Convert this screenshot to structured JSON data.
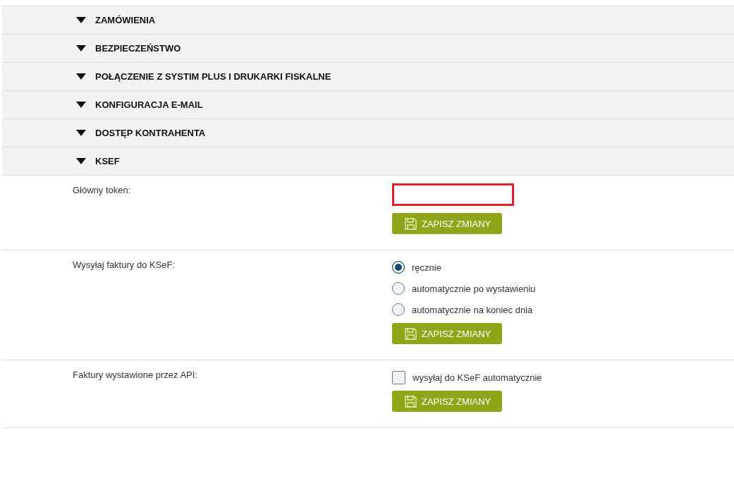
{
  "sections": [
    {
      "title": "ZAMÓWIENIA"
    },
    {
      "title": "BEZPIECZEŃSTWO"
    },
    {
      "title": "POŁĄCZENIE Z SYSTIM PLUS I DRUKARKI FISKALNE"
    },
    {
      "title": "KONFIGURACJA E-MAIL"
    },
    {
      "title": "DOSTĘP KONTRAHENTA"
    },
    {
      "title": "KSEF"
    }
  ],
  "settings": [
    {
      "kind": "field",
      "label": "Główny token:",
      "button": "ZAPISZ ZMIANY"
    },
    {
      "kind": "radio",
      "label": "Wysyłaj faktury do KSeF:",
      "options": [
        {
          "label": "ręcznie",
          "selected": true
        },
        {
          "label": "automatycznie po wystawieniu",
          "selected": false
        },
        {
          "label": "automatycznie na koniec dnia",
          "selected": false
        }
      ],
      "button": "ZAPISZ ZMIANY"
    },
    {
      "kind": "checkbox",
      "label": "Faktury wystawione przez API:",
      "option": {
        "label": "wysyłaj do KSeF automatycznie",
        "checked": false
      },
      "button": "ZAPISZ ZMIANY"
    }
  ]
}
